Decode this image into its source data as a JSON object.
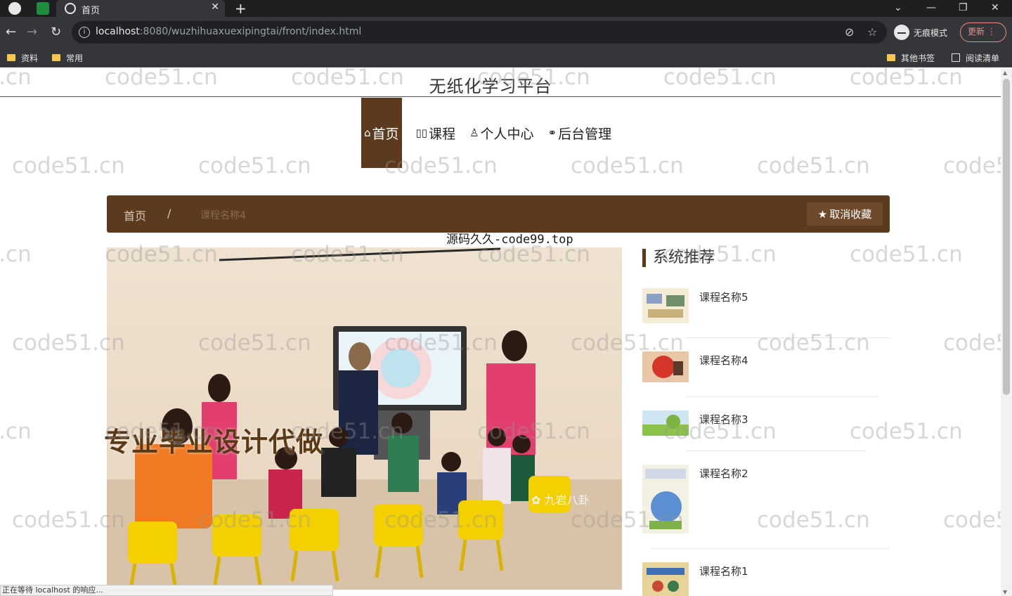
{
  "browser": {
    "tab_title": "首页",
    "url_host": "localhost",
    "url_rest": ":8080/wuzhihuaxuexipingtai/front/index.html",
    "incognito_label": "无痕模式",
    "update_label": "更新",
    "bookmarks": [
      {
        "label": "资料"
      },
      {
        "label": "常用"
      }
    ],
    "other_bookmarks": "其他书签",
    "reading_list": "阅读清单",
    "status_text": "正在等待 localhost 的响应..."
  },
  "site": {
    "title": "无纸化学习平台",
    "nav": [
      {
        "icon": "⌂",
        "label": "首页"
      },
      {
        "icon": "▯▯",
        "label": "课程"
      },
      {
        "icon": "♙",
        "label": "个人中心"
      },
      {
        "icon": "⚭",
        "label": "后台管理"
      }
    ]
  },
  "breadcrumb": {
    "home": "首页",
    "separator": "/",
    "current": "课程名称4",
    "fav_button": "取消收藏"
  },
  "hero": {
    "overlay_text": "源码久久-code99.top",
    "promo_text": "专业毕业设计代做",
    "wechat_text": "九岩八卦"
  },
  "recommend": {
    "heading": "系统推荐",
    "items": [
      {
        "name": "课程名称5"
      },
      {
        "name": "课程名称4"
      },
      {
        "name": "课程名称3"
      },
      {
        "name": "课程名称2"
      },
      {
        "name": "课程名称1"
      }
    ]
  },
  "watermark": "code51.cn",
  "colors": {
    "brand": "#5c3a1e",
    "fav_button": "#6e4a2b",
    "chrome_dark": "#35363a"
  }
}
